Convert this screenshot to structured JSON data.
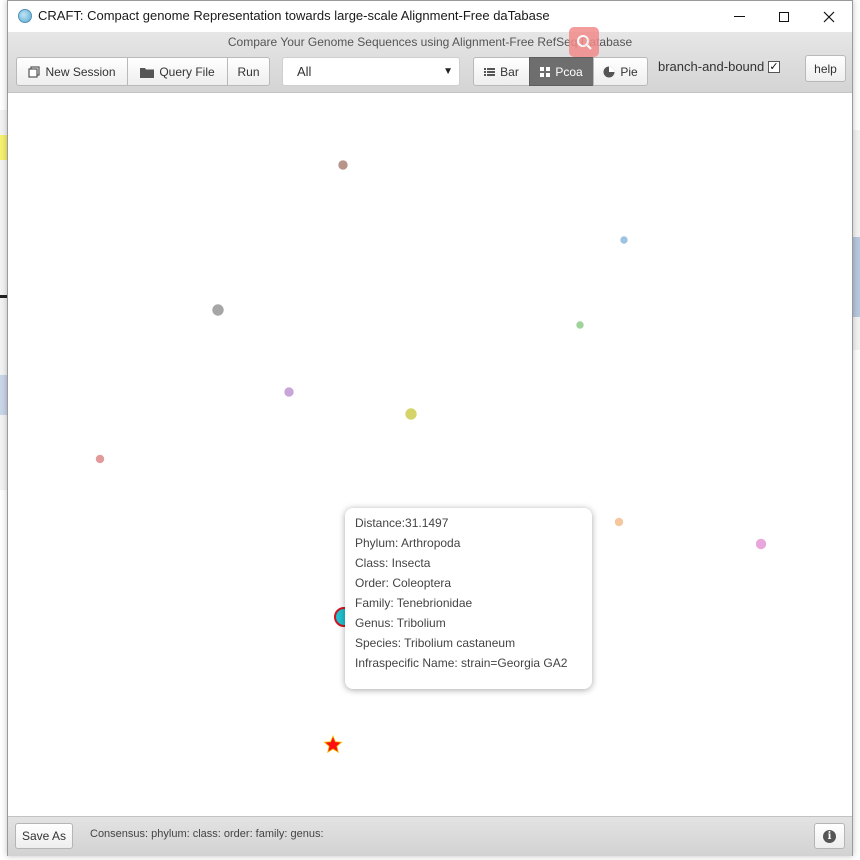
{
  "window": {
    "title": "CRAFT: Compact genome Representation towards large-scale Alignment-Free daTabase",
    "minimize_label": "—",
    "maximize_label": "☐",
    "close_label": "✕"
  },
  "toolbar": {
    "subtitle": "Compare Your Genome Sequences using Alignment-Free RefSeq Database",
    "new_session_label": "New Session",
    "query_file_label": "Query File",
    "run_label": "Run",
    "filter_select_value": "All",
    "bar_label": "Bar",
    "pcoa_label": "Pcoa",
    "pie_label": "Pie",
    "branch_and_bound_label": "branch-and-bound",
    "branch_and_bound_checked": true,
    "help_label": "help"
  },
  "plot": {
    "points": [
      {
        "name": "point-1",
        "color": "#b8948a"
      },
      {
        "name": "point-2",
        "color": "#9ec3e2"
      },
      {
        "name": "point-3",
        "color": "#a6a6a6"
      },
      {
        "name": "point-4",
        "color": "#9fd39a"
      },
      {
        "name": "point-5",
        "color": "#c9a6d9"
      },
      {
        "name": "point-6",
        "color": "#d4d46a"
      },
      {
        "name": "point-7",
        "color": "#e19b9b"
      },
      {
        "name": "point-8",
        "color": "#f5c79e"
      },
      {
        "name": "point-9",
        "color": "#e7a6dc"
      },
      {
        "name": "selected-point",
        "color": "#1fc1d1",
        "stroke": "#d0141e"
      },
      {
        "name": "query-star",
        "color": "#ff1010",
        "stroke": "#f0c000"
      }
    ]
  },
  "tooltip": {
    "distance": "Distance:31.1497",
    "phylum": "Phylum: Arthropoda",
    "class": "Class: Insecta",
    "order": "Order: Coleoptera",
    "family": "Family: Tenebrionidae",
    "genus": "Genus: Tribolium",
    "species": "Species: Tribolium castaneum",
    "infraspecific": "Infraspecific Name: strain=Georgia GA2"
  },
  "statusbar": {
    "save_as_label": "Save As",
    "consensus": "Consensus: phylum: class: order: family: genus:"
  }
}
